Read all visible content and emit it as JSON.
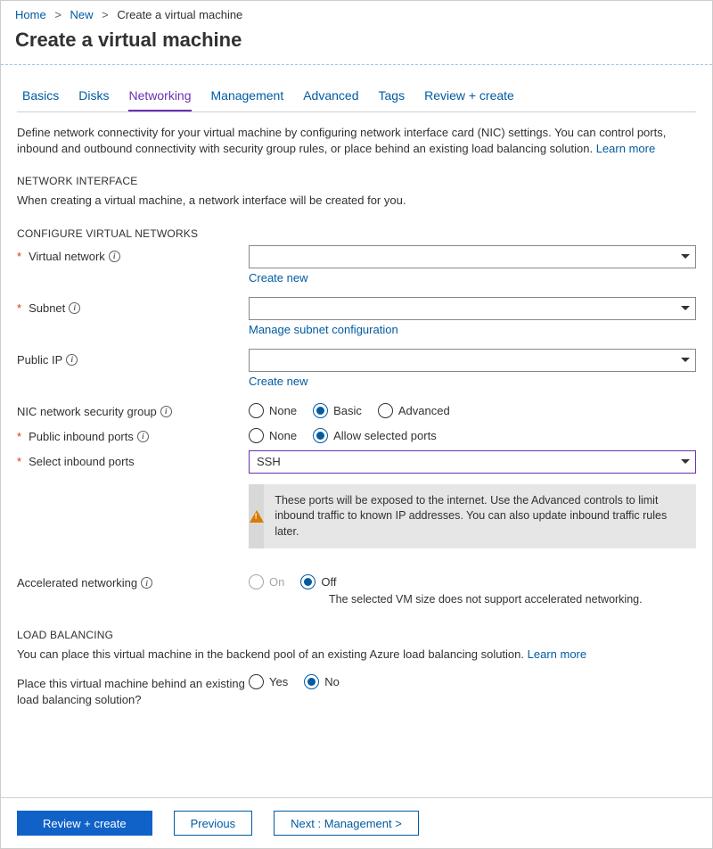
{
  "breadcrumb": {
    "items": [
      "Home",
      "New",
      "Create a virtual machine"
    ]
  },
  "page_title": "Create a virtual machine",
  "tabs": [
    "Basics",
    "Disks",
    "Networking",
    "Management",
    "Advanced",
    "Tags",
    "Review + create"
  ],
  "active_tab_index": 2,
  "intro": {
    "text": "Define network connectivity for your virtual machine by configuring network interface card (NIC) settings. You can control ports, inbound and outbound connectivity with security group rules, or place behind an existing load balancing solution.  ",
    "learn_more": "Learn more"
  },
  "sections": {
    "network_interface": {
      "heading": "NETWORK INTERFACE",
      "text": "When creating a virtual machine, a network interface will be created for you."
    },
    "configure_vnet": {
      "heading": "CONFIGURE VIRTUAL NETWORKS",
      "virtual_network": {
        "label": "Virtual network",
        "value": "",
        "create_new": "Create new"
      },
      "subnet": {
        "label": "Subnet",
        "value": "",
        "manage": "Manage subnet configuration"
      },
      "public_ip": {
        "label": "Public IP",
        "value": "",
        "create_new": "Create new"
      },
      "nic_nsg": {
        "label": "NIC network security group",
        "options": [
          "None",
          "Basic",
          "Advanced"
        ],
        "selected": "Basic"
      },
      "inbound_ports": {
        "label": "Public inbound ports",
        "options": [
          "None",
          "Allow selected ports"
        ],
        "selected": "Allow selected ports"
      },
      "select_ports": {
        "label": "Select inbound ports",
        "value": "SSH"
      },
      "warning": "These ports will be exposed to the internet. Use the Advanced controls to limit inbound traffic to known IP addresses. You can also update inbound traffic rules later.",
      "accel_net": {
        "label": "Accelerated networking",
        "options": [
          "On",
          "Off"
        ],
        "selected": "Off",
        "hint": "The selected VM size does not support accelerated networking."
      }
    },
    "load_balancing": {
      "heading": "LOAD BALANCING",
      "text": "You can place this virtual machine in the backend pool of an existing Azure load balancing solution.  ",
      "learn_more": "Learn more",
      "place_behind": {
        "label": "Place this virtual machine behind an existing load balancing solution?",
        "options": [
          "Yes",
          "No"
        ],
        "selected": "No"
      }
    }
  },
  "buttons": {
    "review": "Review + create",
    "previous": "Previous",
    "next": "Next : Management >"
  }
}
